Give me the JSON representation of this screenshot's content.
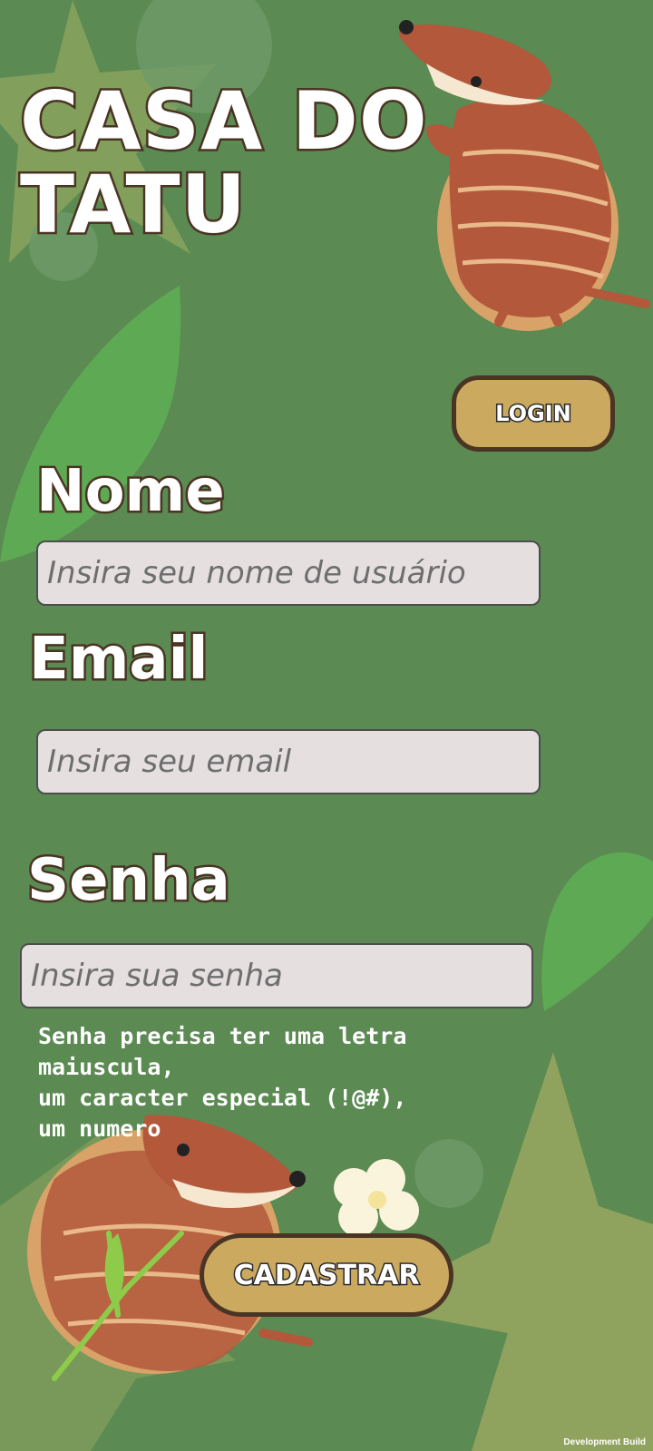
{
  "app": {
    "title_line1": "CASA DO",
    "title_line2": "TATU"
  },
  "header": {
    "login_label": "LOGIN"
  },
  "form": {
    "name_label": "Nome",
    "name_placeholder": "Insira seu nome de usuário",
    "email_label": "Email",
    "email_placeholder": "Insira seu email",
    "password_label": "Senha",
    "password_placeholder": "Insira sua senha",
    "password_hint": "Senha precisa ter uma letra maiuscula,\num caracter especial (!@#),\num numero",
    "submit_label": "CADASTRAR"
  },
  "footer": {
    "build_label": "Development Build"
  },
  "colors": {
    "background": "#5b8a52",
    "button": "#cba95f",
    "input": "#e5dfe0",
    "outline": "#4a3423"
  }
}
